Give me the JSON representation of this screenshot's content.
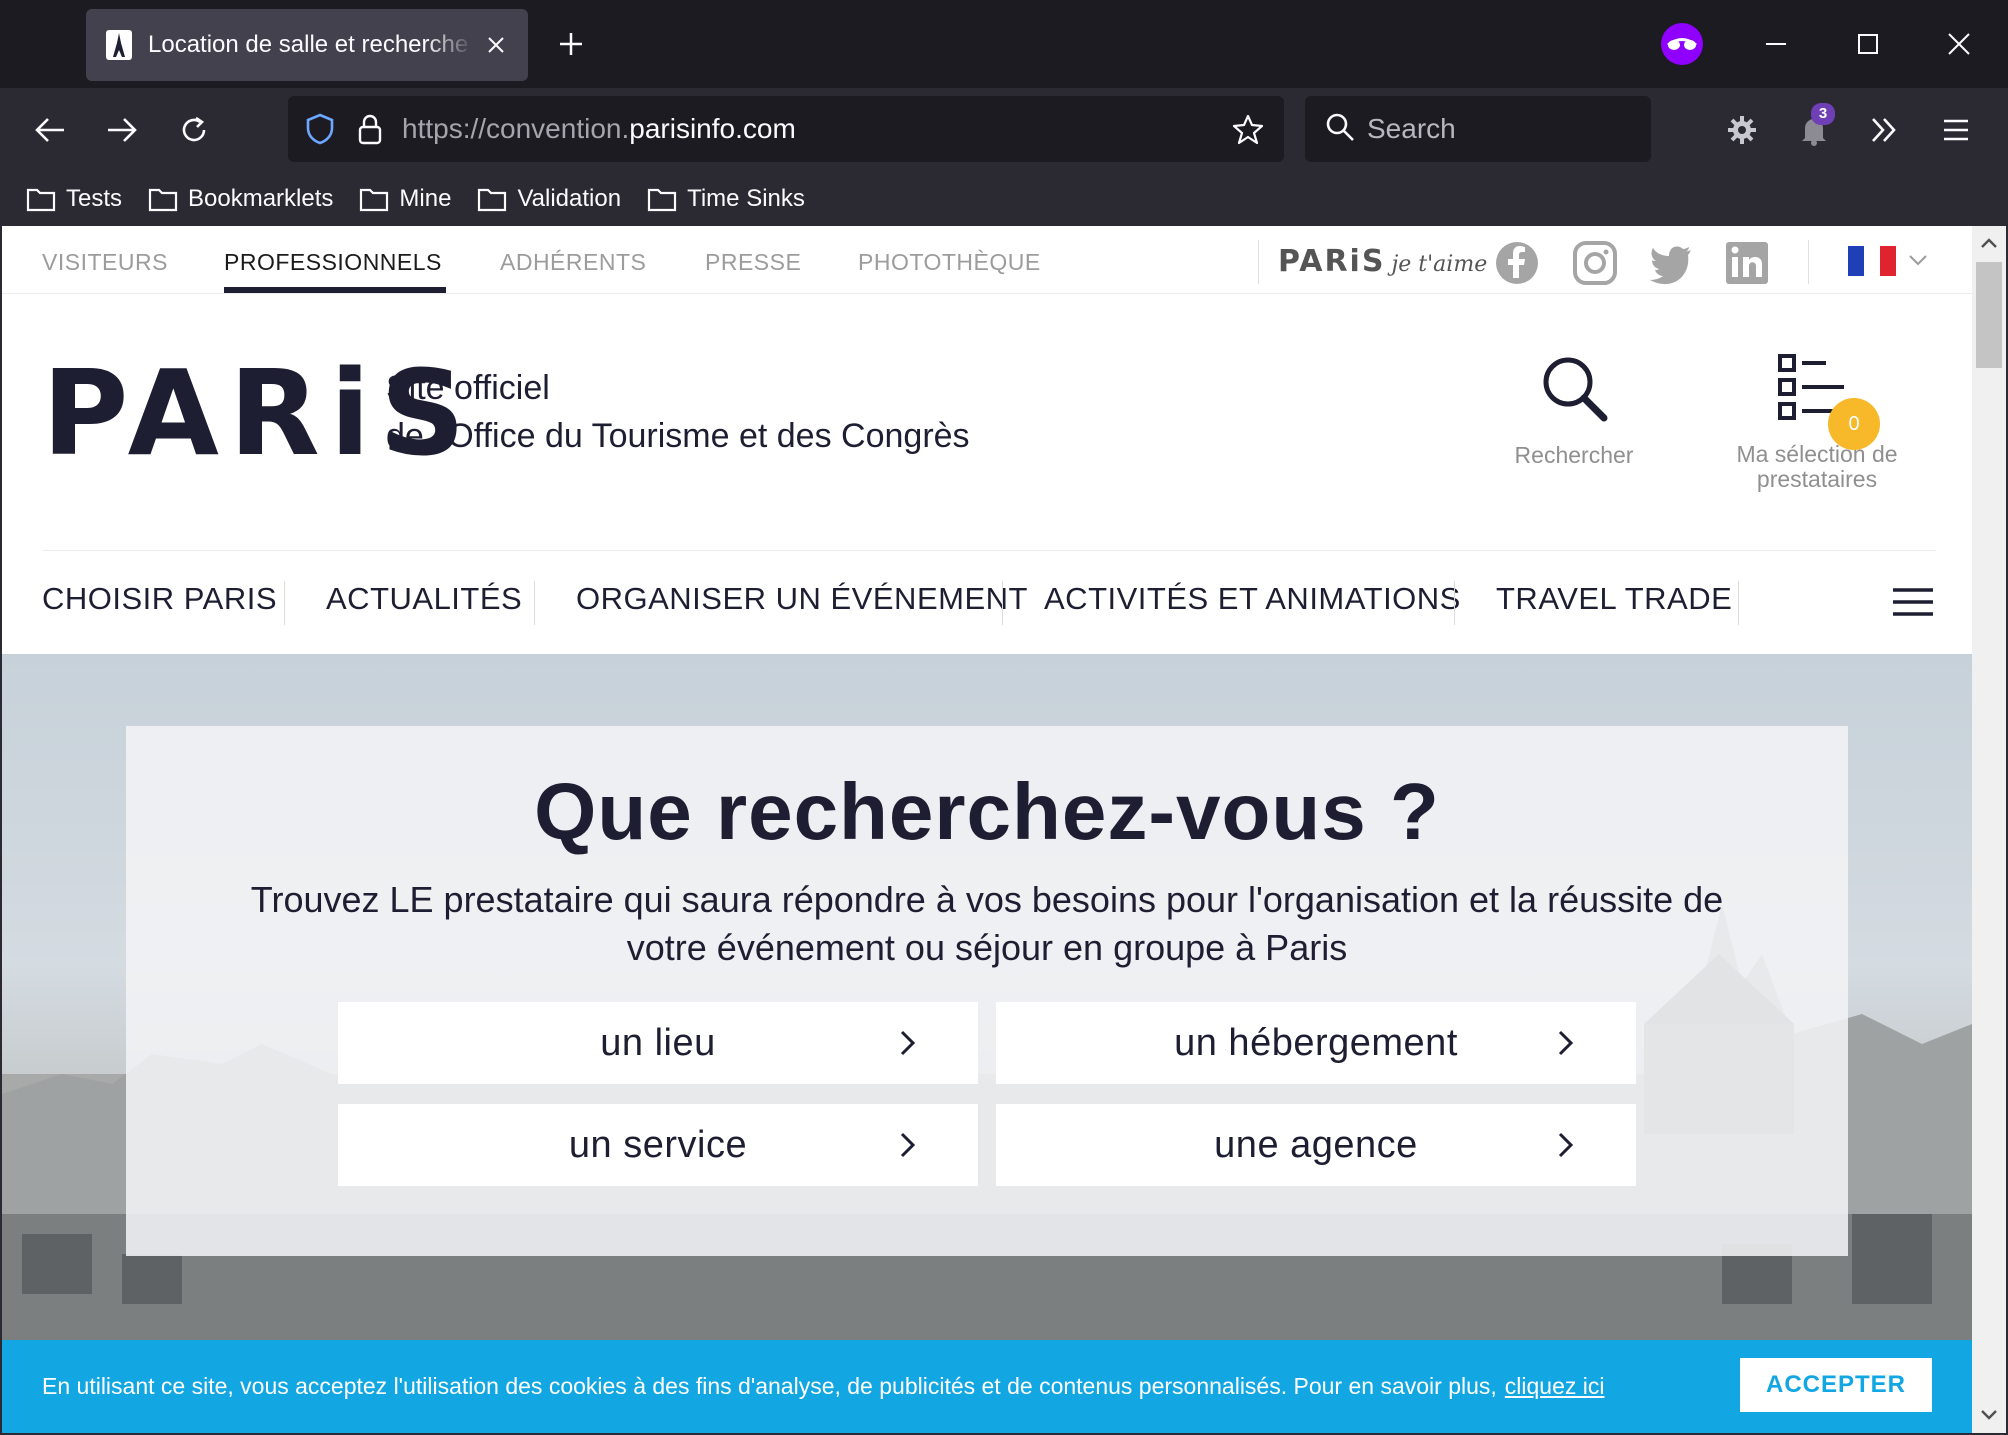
{
  "browser": {
    "tab_title": "Location de salle et recherche de prestataires",
    "url_prefix": "https://convention.",
    "url_domain": "parisinfo.com",
    "search_placeholder": "Search",
    "notification_count": "3",
    "bookmarks": [
      "Tests",
      "Bookmarklets",
      "Mine",
      "Validation",
      "Time Sinks"
    ]
  },
  "site": {
    "topnav": [
      "VISITEURS",
      "PROFESSIONNELS",
      "ADHÉRENTS",
      "PRESSE",
      "PHOTOTHÈQUE"
    ],
    "active_topnav": "PROFESSIONNELS",
    "jetaime_brand": "PARiS",
    "jetaime_script": "je t'aime",
    "social": [
      "facebook-icon",
      "instagram-icon",
      "twitter-icon",
      "linkedin-icon"
    ],
    "language": "fr",
    "logo": "PARiS",
    "tagline_line1": "Site officiel",
    "tagline_line2": "de l'Office du Tourisme et des Congrès",
    "search_label": "Rechercher",
    "selection_label_line1": "Ma sélection de",
    "selection_label_line2": "prestataires",
    "selection_count": "0",
    "mainnav": [
      "CHOISIR PARIS",
      "ACTUALITÉS",
      "ORGANISER UN ÉVÉNEMENT",
      "ACTIVITÉS ET ANIMATIONS",
      "TRAVEL TRADE"
    ]
  },
  "hero": {
    "title": "Que recherchez-vous ?",
    "lead": "Trouvez LE prestataire qui saura répondre à vos besoins pour l'organisation et la réussite de votre événement ou séjour en groupe à Paris",
    "choices": [
      "un lieu",
      "un hébergement",
      "un service",
      "une agence"
    ]
  },
  "cookie": {
    "message": "En utilisant ce site, vous acceptez l'utilisation des cookies à des fins d'analyse, de publicités et de contenus personnalisés. Pour en savoir plus,",
    "link": "cliquez ici",
    "accept": "ACCEPTER"
  },
  "colors": {
    "brand_navy": "#1e1e32",
    "cookie_blue": "#12a6e3",
    "badge_yellow": "#f7b82a"
  }
}
